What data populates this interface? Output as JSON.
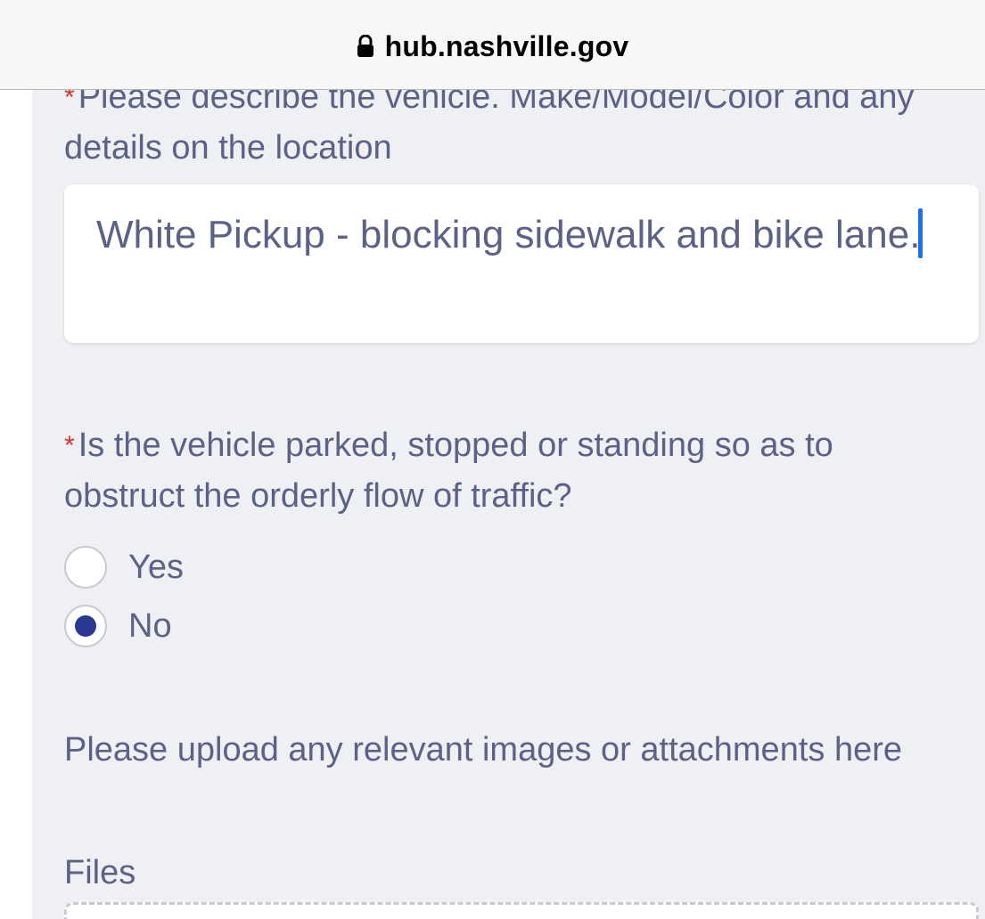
{
  "browser": {
    "url": "hub.nashville.gov"
  },
  "form": {
    "required_marker": "*",
    "vehicle_question": {
      "label": "Please describe the vehicle. Make/Model/Color and any details on the location",
      "value": "White Pickup - blocking sidewalk and bike lane."
    },
    "obstruct_question": {
      "label": "Is the vehicle parked, stopped or standing so as to obstruct the orderly flow of traffic?",
      "options": [
        {
          "label": "Yes",
          "selected": false
        },
        {
          "label": "No",
          "selected": true
        }
      ]
    },
    "upload_label": "Please upload any relevant images or attachments here",
    "files_label": "Files"
  },
  "colors": {
    "text": "#5b6285",
    "required": "#e0302d",
    "radio_selected": "#2a3990",
    "caret": "#1a6ff5",
    "background": "#eff0f4"
  }
}
